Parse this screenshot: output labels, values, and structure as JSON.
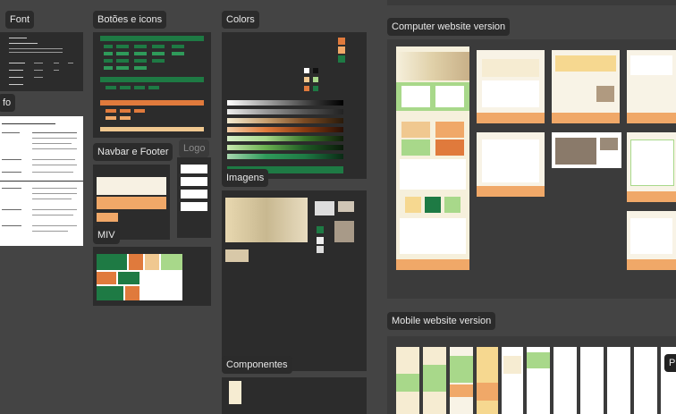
{
  "boards": {
    "font": "Font",
    "info": "fo",
    "buttons_icons": "Botões e icons",
    "navbar_footer": "Navbar e Footer",
    "logo": "Logo",
    "miv": "MIV",
    "colors": "Colors",
    "images": "Imagens",
    "components": "Componentes",
    "computer": "Computer website version",
    "mobile": "Mobile website version",
    "partial_right": "P"
  },
  "colors": {
    "canvas": "#444444",
    "board": "#2c2c2c",
    "brand_green": "#1e7a44",
    "brand_orange": "#e07a3c",
    "light_green": "#a8d88a",
    "cream": "#f6ecd2",
    "peach": "#f0a868"
  }
}
